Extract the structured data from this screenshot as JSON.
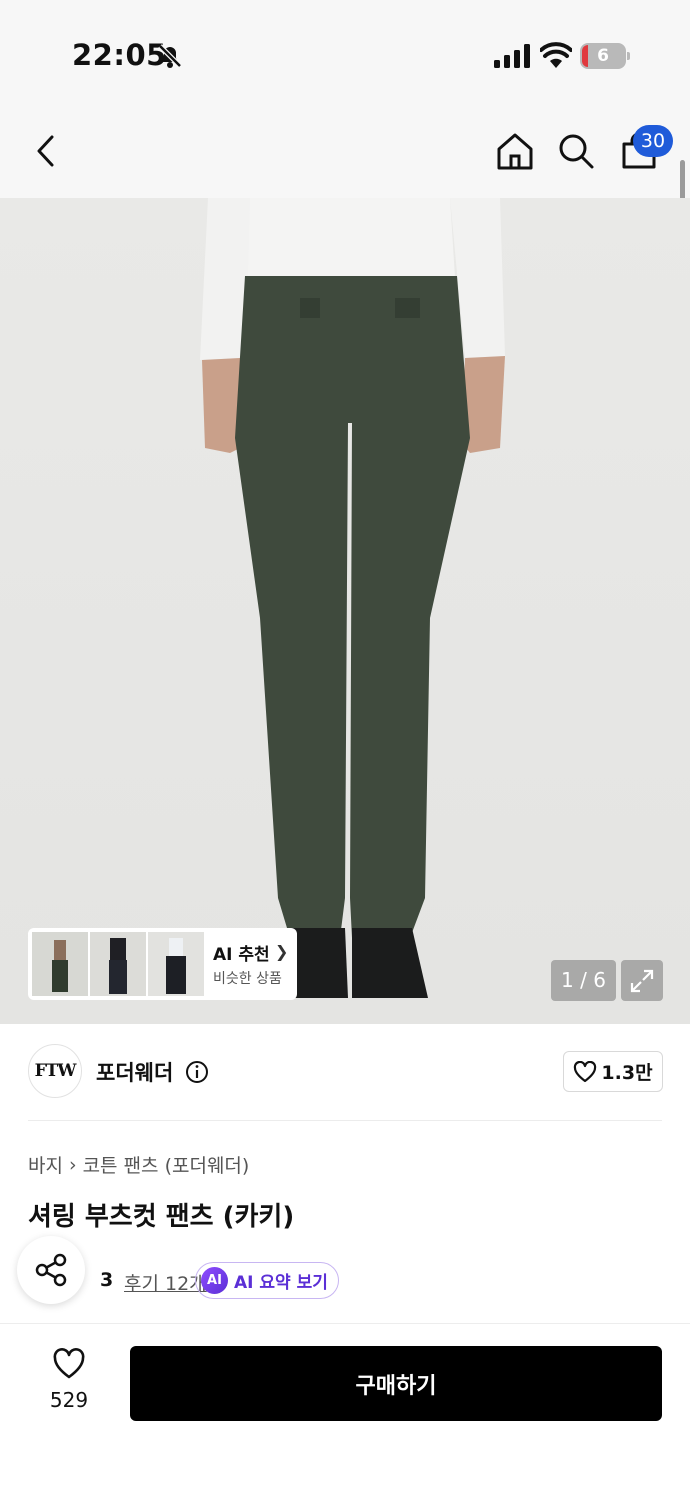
{
  "status_bar": {
    "time": "22:05",
    "battery_level": "6",
    "icons": [
      "bell-slash-icon",
      "cellular-signal-icon",
      "wifi-icon",
      "battery-icon"
    ]
  },
  "nav": {
    "cart_count": "30",
    "icons": [
      "chevron-left-icon",
      "home-icon",
      "search-icon",
      "shopping-bag-icon"
    ]
  },
  "gallery": {
    "counter": "1 / 6",
    "ai_recommend": {
      "title": "AI 추천",
      "subtitle": "비슷한 상품"
    }
  },
  "brand": {
    "logo_text": "FTW",
    "name": "포더웨더",
    "likes": "1.3만"
  },
  "product": {
    "breadcrumb": [
      "바지",
      "코튼 팬츠 (포더웨더)"
    ],
    "title": "셔링 부츠컷 팬츠 (카키)",
    "rating": "3",
    "review_label": "후기 12개",
    "ai_badge": "AI",
    "ai_summary_label": "AI 요약 보기"
  },
  "bottom_bar": {
    "like_count": "529",
    "buy_label": "구매하기"
  },
  "colors": {
    "accent_blue": "#1f5bd9",
    "ai_purple": "#5b2fd6",
    "buy_button": "#000000",
    "pants_khaki": "#3f4a3d"
  }
}
